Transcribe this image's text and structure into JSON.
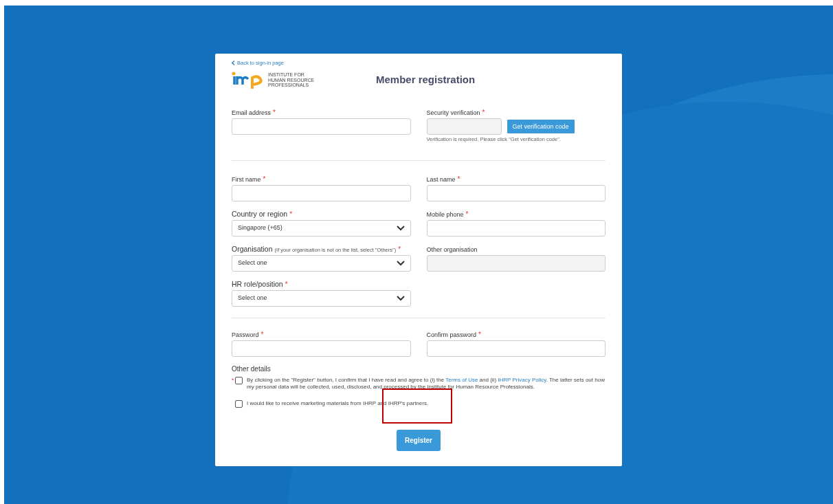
{
  "back_link": "Back to sign-in page",
  "logo_text": [
    "INSTITUTE FOR",
    "HUMAN RESOURCE",
    "PROFESSIONALS"
  ],
  "title": "Member registration",
  "sections": [
    {
      "fields": [
        {
          "kind": "text",
          "label": "Email address",
          "asterisk": "*"
        },
        {
          "kind": "verification",
          "label": "Security verification",
          "asterisk": "*",
          "button": "Get verification code",
          "hint": "Verification is required. Please click \"Get verification code\"."
        }
      ]
    },
    {
      "fields": [
        {
          "kind": "text",
          "label": "First name",
          "asterisk": "*"
        },
        {
          "kind": "text",
          "label": "Last name",
          "asterisk": "*"
        },
        {
          "kind": "select",
          "label": "Country or region",
          "asterisk": "*",
          "value": "Singapore (+65)"
        },
        {
          "kind": "text",
          "label": "Mobile phone",
          "asterisk": "*"
        },
        {
          "kind": "select",
          "label": "Organisation",
          "note": "(If your organisation is not on the list, select \"Others\")",
          "asterisk": "*",
          "value": "Select one"
        },
        {
          "kind": "text",
          "label": "Other organisation",
          "disabled": true
        },
        {
          "kind": "select",
          "label": "HR role/position",
          "asterisk": "*",
          "value": "Select one"
        }
      ]
    },
    {
      "fields": [
        {
          "kind": "text",
          "label": "Password",
          "asterisk": "*"
        },
        {
          "kind": "text",
          "label": "Confirm password",
          "asterisk": "*"
        }
      ]
    }
  ],
  "other_details": {
    "heading": "Other details",
    "consents": [
      {
        "asterisk": "*",
        "checked": false,
        "parts": [
          {
            "kind": "text",
            "text": "By clicking on the \"Register\" button, I confirm that I have read and agree to (i) the "
          },
          {
            "kind": "link",
            "text": "Terms of Use"
          },
          {
            "kind": "text",
            "text": " and (ii) "
          },
          {
            "kind": "link",
            "text": "IHRP Privacy Policy"
          },
          {
            "kind": "text",
            "text": ". The latter sets out how my personal data will be collected, used, disclosed, and processed by the Institute for Human Resource Professionals."
          }
        ]
      },
      {
        "checked": false,
        "parts": [
          {
            "kind": "text",
            "text": "I would like to receive marketing materials from IHRP and IHRP's partners."
          }
        ]
      }
    ]
  },
  "submit": "Register"
}
